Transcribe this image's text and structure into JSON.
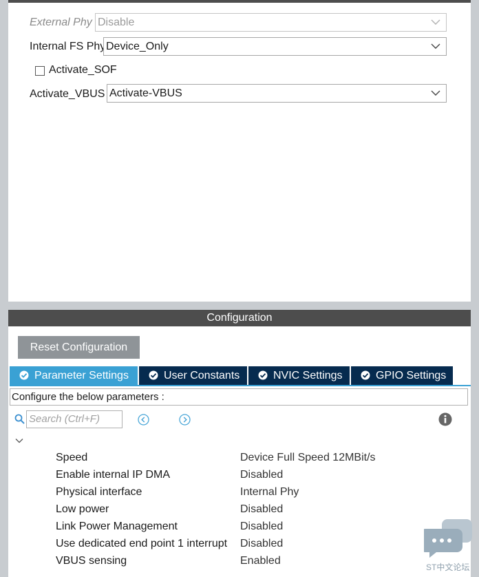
{
  "mode": {
    "external_phy": {
      "label": "External Phy",
      "value": "Disable"
    },
    "internal_fs_phy": {
      "label": "Internal FS Phy",
      "value": "Device_Only"
    },
    "activate_sof": {
      "label": "Activate_SOF",
      "checked": false
    },
    "activate_vbus": {
      "label": "Activate_VBUS",
      "value": "Activate-VBUS"
    }
  },
  "configuration": {
    "title": "Configuration",
    "reset_label": "Reset Configuration",
    "tabs": [
      {
        "label": "Parameter Settings",
        "active": true
      },
      {
        "label": "User Constants",
        "active": false
      },
      {
        "label": "NVIC Settings",
        "active": false
      },
      {
        "label": "GPIO Settings",
        "active": false
      }
    ],
    "description": "Configure the below parameters :",
    "search_placeholder": "Search (Ctrl+F)",
    "params": [
      {
        "name": "Speed",
        "value": "Device Full Speed 12MBit/s"
      },
      {
        "name": "Enable internal IP DMA",
        "value": "Disabled"
      },
      {
        "name": "Physical interface",
        "value": "Internal Phy"
      },
      {
        "name": "Low power",
        "value": "Disabled"
      },
      {
        "name": "Link Power Management",
        "value": "Disabled"
      },
      {
        "name": "Use dedicated end point 1 interrupt",
        "value": "Disabled"
      },
      {
        "name": "VBUS sensing",
        "value": "Enabled"
      }
    ]
  },
  "watermark": {
    "text": "ST中文论坛"
  },
  "colors": {
    "accent": "#3aa1d4",
    "tab_dark": "#062b4f",
    "header": "#4d4d4d",
    "button": "#8f9498"
  }
}
